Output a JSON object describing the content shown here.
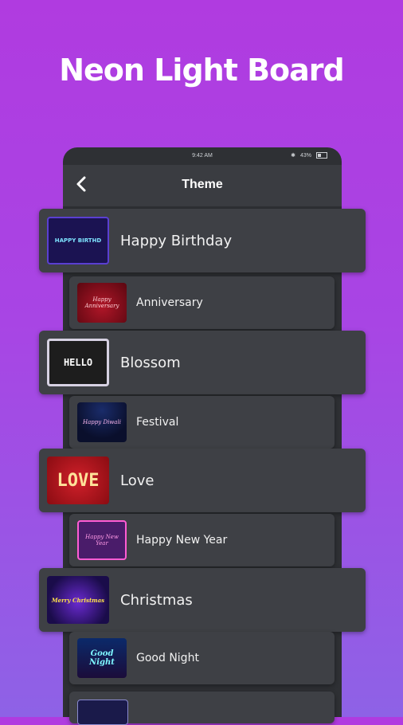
{
  "headline": "Neon Light Board",
  "status": {
    "time": "9:42 AM",
    "battery_text": "43%",
    "battery_level": 0.43
  },
  "nav": {
    "title": "Theme",
    "back_icon": "chevron-left-icon"
  },
  "themes": [
    {
      "name": "Happy Birthday",
      "thumb_text": "HAPPY BIRTHD",
      "size": "big"
    },
    {
      "name": "Anniversary",
      "thumb_text": "Happy Anniversary",
      "size": "small"
    },
    {
      "name": "Blossom",
      "thumb_text": "HELLO",
      "size": "big"
    },
    {
      "name": "Festival",
      "thumb_text": "Happy Diwali",
      "size": "small"
    },
    {
      "name": "Love",
      "thumb_text": "LOVE",
      "size": "big"
    },
    {
      "name": "Happy New Year",
      "thumb_text": "Happy New Year",
      "size": "small"
    },
    {
      "name": "Christmas",
      "thumb_text": "Merry Christmas",
      "size": "big"
    },
    {
      "name": "Good Night",
      "thumb_text": "Good Night",
      "size": "small"
    }
  ]
}
